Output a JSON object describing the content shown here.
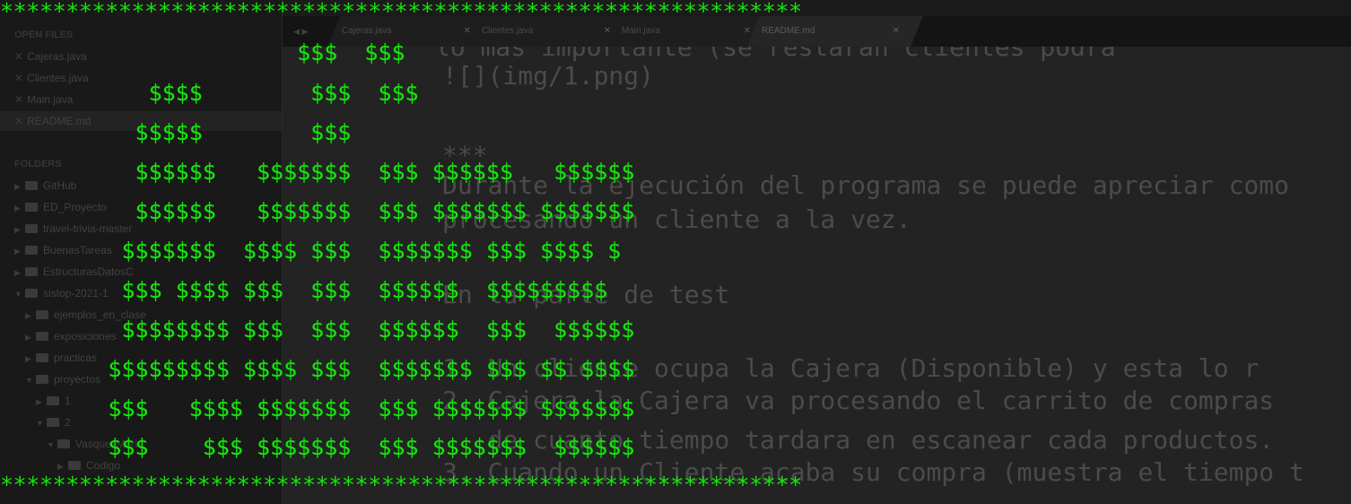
{
  "sidebar": {
    "open_files_header": "OPEN FILES",
    "open_files": [
      {
        "label": "Cajeras.java",
        "selected": false
      },
      {
        "label": "Clientes.java",
        "selected": false
      },
      {
        "label": "Main.java",
        "selected": false
      },
      {
        "label": "README.md",
        "selected": true
      }
    ],
    "folders_header": "FOLDERS",
    "folders": [
      {
        "label": "GitHub",
        "expanded": false
      },
      {
        "label": "ED_Proyecto",
        "expanded": false
      },
      {
        "label": "travel-trivia-master",
        "expanded": false
      },
      {
        "label": "BuenasTareas",
        "expanded": false
      },
      {
        "label": "EstructurasDatosC",
        "expanded": false
      },
      {
        "label": "sistop-2021-1",
        "expanded": true
      },
      {
        "label": "ejemplos_en_clase",
        "expanded": false
      },
      {
        "label": "exposiciones",
        "expanded": false
      },
      {
        "label": "practicas",
        "expanded": false
      },
      {
        "label": "proyectos",
        "expanded": true
      },
      {
        "label": "1",
        "expanded": false
      },
      {
        "label": "2",
        "expanded": true
      },
      {
        "label": "VasquezMario",
        "expanded": true
      },
      {
        "label": "Codigo",
        "expanded": false
      }
    ]
  },
  "tabs": [
    {
      "label": "Cajeras.java",
      "active": false
    },
    {
      "label": "Clientes.java",
      "active": false
    },
    {
      "label": "Main.java",
      "active": false
    },
    {
      "label": "README.md",
      "active": true
    }
  ],
  "editor": {
    "lines": [
      "lo mas importante (se restaran clientes podra",
      "![](img/1.png)",
      "",
      "***",
      "Durante la ejecución del programa se puede apreciar como",
      "procesando un cliente a la vez.",
      "",
      "En la parte de test",
      "",
      "1. Un cliente ocupa la Cajera (Disponible) y esta lo r",
      "2. Cajera la Cajera va procesando el carrito de compras",
      "   de cuanto tiempo tardara en escanear cada productos.",
      "3. Cuando un Cliente acaba su compra (muestra el tiempo t"
    ]
  },
  "banner": {
    "color": "#17e50f",
    "star_line": "*************************************************************",
    "art_lines": [
      "                      $$$  $$$",
      "           $$$$        $$$  $$$",
      "          $$$$$        $$$",
      "          $$$$$$   $$$$$$$  $$$ $$$$$$   $$$$$$",
      "          $$$$$$   $$$$$$$  $$$ $$$$$$$ $$$$$$$",
      "         $$$$$$$  $$$$ $$$  $$$$$$$ $$$ $$$$ $",
      "         $$$ $$$$ $$$  $$$  $$$$$$  $$$$$$$$$",
      "         $$$$$$$$ $$$  $$$  $$$$$$  $$$  $$$$$$",
      "        $$$$$$$$$ $$$$ $$$  $$$$$$$ $$$ $$ $$$$",
      "        $$$   $$$$ $$$$$$$  $$$ $$$$$$$ $$$$$$$",
      "        $$$    $$$ $$$$$$$  $$$ $$$$$$$  $$$$$$"
    ]
  }
}
